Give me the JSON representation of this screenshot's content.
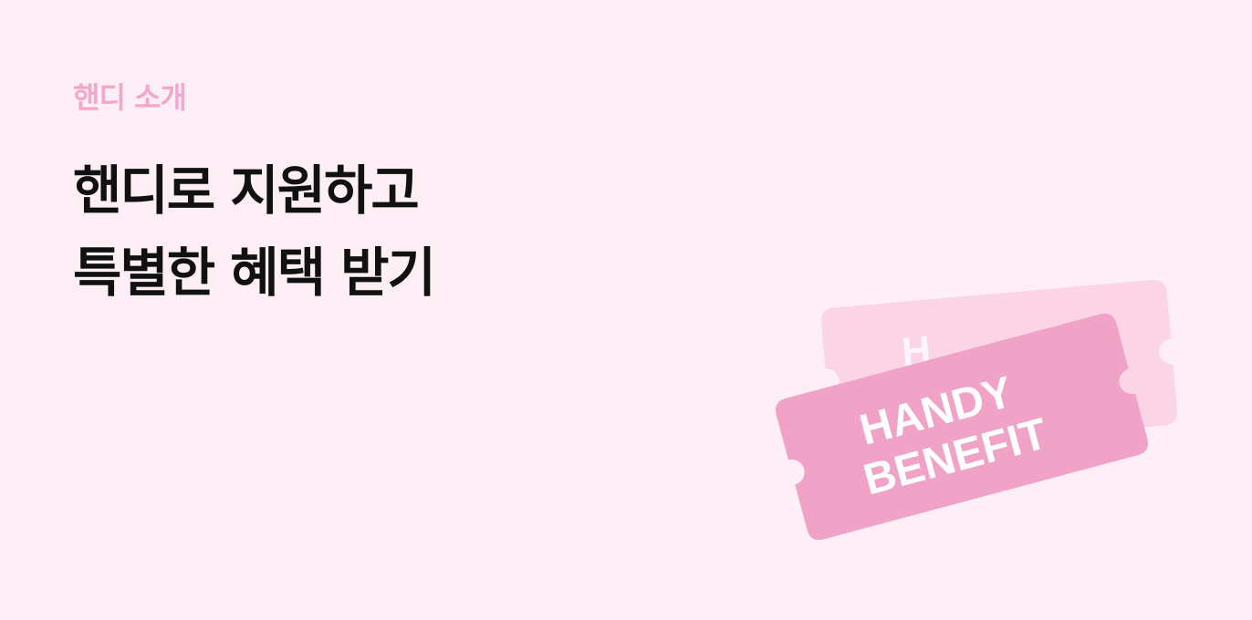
{
  "section": {
    "eyebrow": "핸디 소개"
  },
  "headline": {
    "line1": "핸디로 지원하고",
    "line2": "특별한 혜택 받기"
  },
  "ticket": {
    "front_line1": "HANDY",
    "front_line2": "BENEFIT",
    "back_peek_text": "H",
    "front_color": "#F0A2C7",
    "back_color": "#FBD4E6",
    "text_color": "#FFFFFF"
  },
  "colors": {
    "background": "#FEEEF6",
    "eyebrow": "#F3A7CB",
    "headline": "#111111"
  }
}
